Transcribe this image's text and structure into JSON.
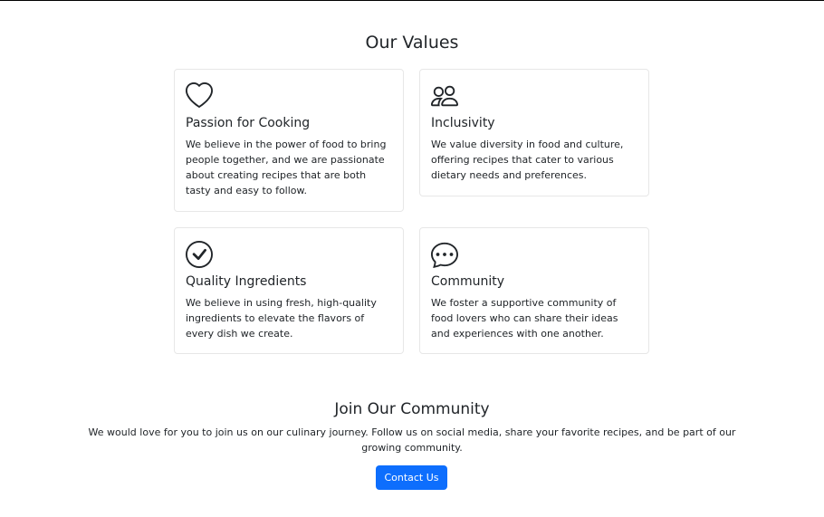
{
  "values": {
    "title": "Our Values",
    "cards": [
      {
        "icon": "heart-icon",
        "title": "Passion for Cooking",
        "text": "We believe in the power of food to bring people together, and we are passionate about creating recipes that are both tasty and easy to follow."
      },
      {
        "icon": "people-icon",
        "title": "Inclusivity",
        "text": "We value diversity in food and culture, offering recipes that cater to various dietary needs and preferences."
      },
      {
        "icon": "check-circle-icon",
        "title": "Quality Ingredients",
        "text": "We believe in using fresh, high-quality ingredients to elevate the flavors of every dish we create."
      },
      {
        "icon": "chat-dots-icon",
        "title": "Community",
        "text": "We foster a supportive community of food lovers who can share their ideas and experiences with one another."
      }
    ]
  },
  "join": {
    "title": "Join Our Community",
    "text": "We would love for you to join us on our culinary journey. Follow us on social media, share your favorite recipes, and be part of our growing community.",
    "button_label": "Contact Us"
  },
  "colors": {
    "primary": "#0d6efd",
    "text": "#212529",
    "card_border": "#e7e7e7"
  }
}
